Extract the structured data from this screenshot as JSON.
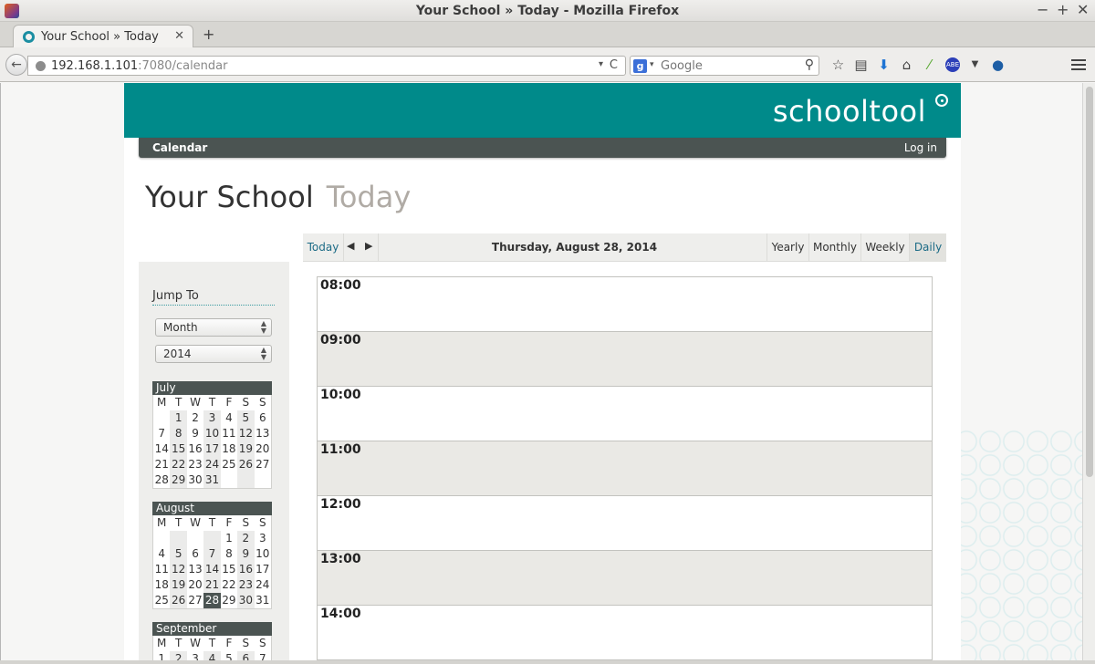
{
  "window": {
    "title": "Your School » Today - Mozilla Firefox",
    "controls": [
      "−",
      "+",
      "✕"
    ]
  },
  "tab": {
    "title": "Your School » Today",
    "close": "✕",
    "new_tab": "+"
  },
  "navbar": {
    "back": "←",
    "url_host": "192.168.1.101",
    "url_rest": ":7080/calendar",
    "url_dropdown": "▾",
    "reload": "C",
    "search_engine_letter": "g",
    "search_dropdown": "▾",
    "search_placeholder": "Google",
    "search_icon": "⚲",
    "toolbar_icons": [
      "bookmark-star-icon",
      "reading-list-icon",
      "download-icon",
      "home-icon",
      "leaf-icon",
      "abe-icon",
      "dropdown-icon",
      "addon-orb-icon"
    ]
  },
  "site": {
    "logo_text": "schooltool",
    "nav_calendar": "Calendar",
    "nav_login": "Log in",
    "accent_color": "#008a8a",
    "dark_color": "#4b5452"
  },
  "heading": {
    "title": "Your School",
    "subtitle": "Today"
  },
  "sidebar": {
    "jump_to": "Jump To",
    "period_select": "Month",
    "year_select": "2014"
  },
  "mini_calendars": [
    {
      "month": "July",
      "weekdays": [
        "M",
        "T",
        "W",
        "T",
        "F",
        "S",
        "S"
      ],
      "weeks": [
        [
          "",
          "1",
          "2",
          "3",
          "4",
          "5",
          "6"
        ],
        [
          "7",
          "8",
          "9",
          "10",
          "11",
          "12",
          "13"
        ],
        [
          "14",
          "15",
          "16",
          "17",
          "18",
          "19",
          "20"
        ],
        [
          "21",
          "22",
          "23",
          "24",
          "25",
          "26",
          "27"
        ],
        [
          "28",
          "29",
          "30",
          "31",
          "",
          "",
          ""
        ]
      ]
    },
    {
      "month": "August",
      "weekdays": [
        "M",
        "T",
        "W",
        "T",
        "F",
        "S",
        "S"
      ],
      "weeks": [
        [
          "",
          "",
          "",
          "",
          "1",
          "2",
          "3"
        ],
        [
          "4",
          "5",
          "6",
          "7",
          "8",
          "9",
          "10"
        ],
        [
          "11",
          "12",
          "13",
          "14",
          "15",
          "16",
          "17"
        ],
        [
          "18",
          "19",
          "20",
          "21",
          "22",
          "23",
          "24"
        ],
        [
          "25",
          "26",
          "27",
          "28",
          "29",
          "30",
          "31"
        ]
      ],
      "today": "28"
    },
    {
      "month": "September",
      "weekdays": [
        "M",
        "T",
        "W",
        "T",
        "F",
        "S",
        "S"
      ],
      "weeks": [
        [
          "1",
          "2",
          "3",
          "4",
          "5",
          "6",
          "7"
        ]
      ]
    }
  ],
  "calendar": {
    "today_button": "Today",
    "prev": "◀",
    "next": "▶",
    "date": "Thursday, August 28, 2014",
    "views": [
      "Yearly",
      "Monthly",
      "Weekly",
      "Daily"
    ],
    "active_view": "Daily",
    "hours": [
      "08:00",
      "09:00",
      "10:00",
      "11:00",
      "12:00",
      "13:00",
      "14:00"
    ]
  }
}
